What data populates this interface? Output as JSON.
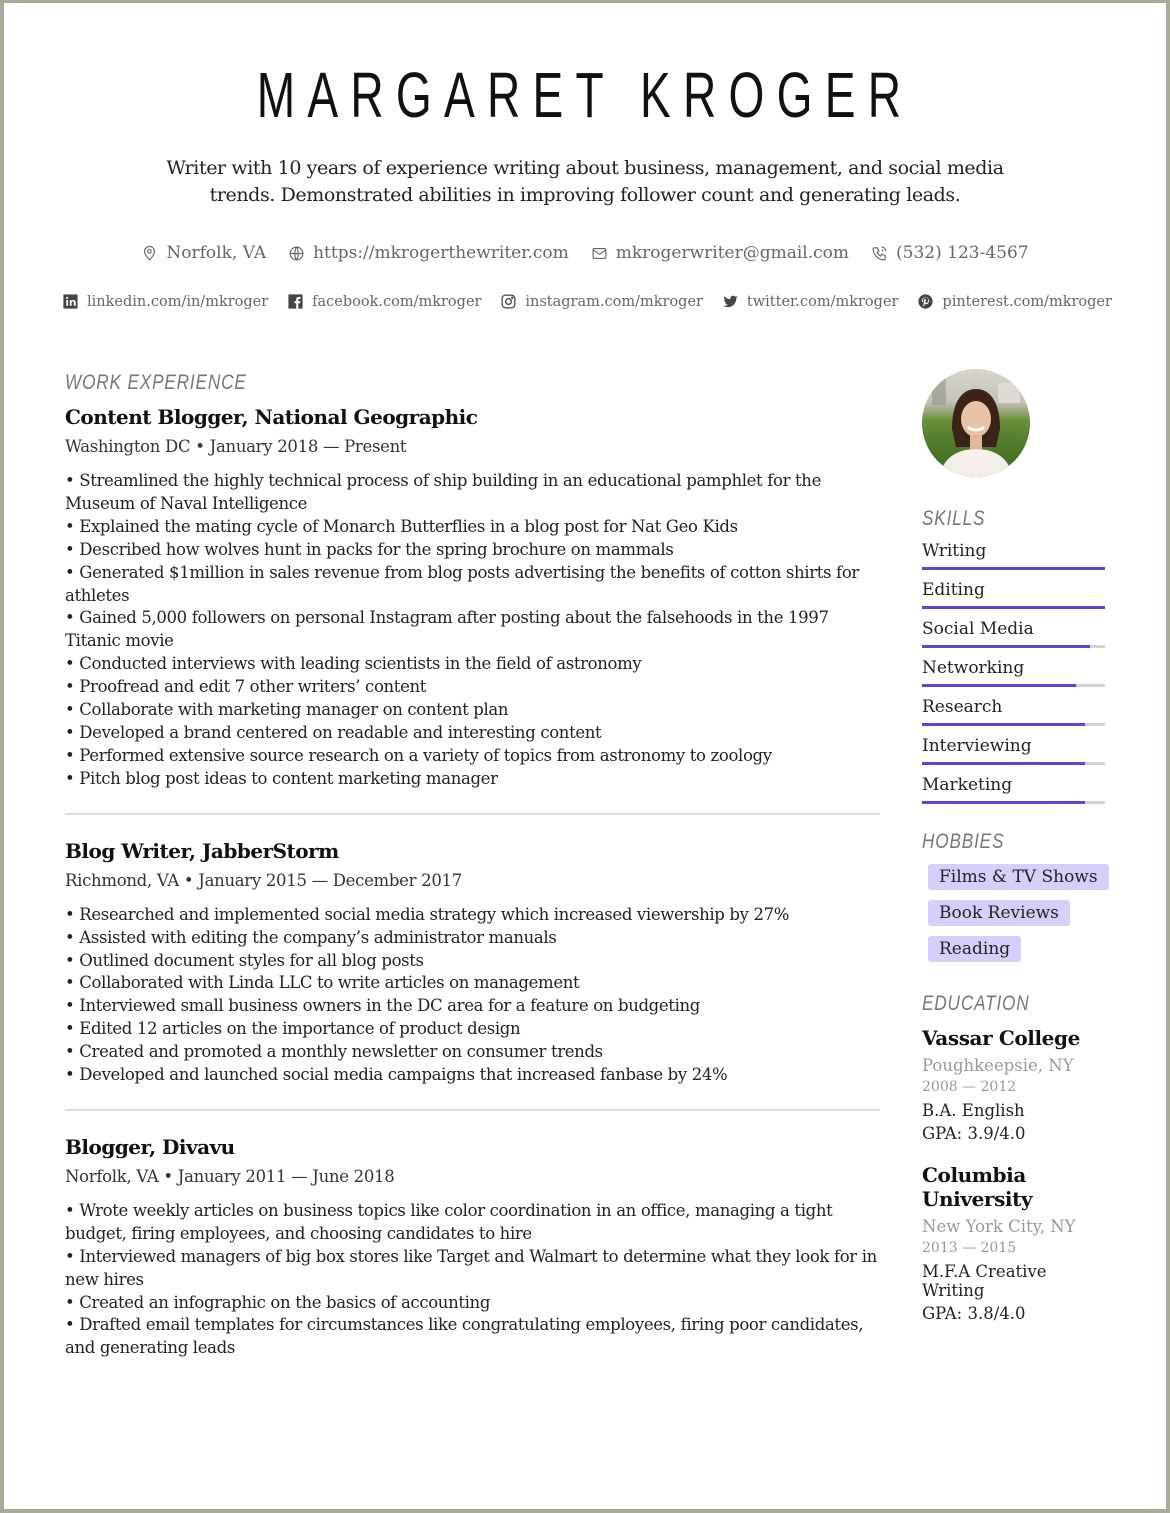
{
  "header": {
    "name": "MARGARET KROGER",
    "summary": "Writer with 10 years of experience writing about business, management, and social media trends. Demonstrated abilities in improving follower count and generating leads."
  },
  "contact": [
    {
      "icon": "location-pin-icon",
      "text": "Norfolk, VA"
    },
    {
      "icon": "globe-icon",
      "text": "https://mkrogerthewriter.com"
    },
    {
      "icon": "envelope-icon",
      "text": "mkrogerwriter@gmail.com"
    },
    {
      "icon": "phone-icon",
      "text": "(532) 123-4567"
    }
  ],
  "social": [
    {
      "icon": "linkedin-icon",
      "text": "linkedin.com/in/mkroger"
    },
    {
      "icon": "facebook-icon",
      "text": "facebook.com/mkroger"
    },
    {
      "icon": "instagram-icon",
      "text": "instagram.com/mkroger"
    },
    {
      "icon": "twitter-icon",
      "text": "twitter.com/mkroger"
    },
    {
      "icon": "pinterest-icon",
      "text": "pinterest.com/mkroger"
    }
  ],
  "work": {
    "title": "WORK EXPERIENCE",
    "jobs": [
      {
        "title": "Content Blogger, National Geographic",
        "meta": "Washington DC • January 2018 — Present",
        "bullets": [
          "• Streamlined the highly technical process of ship building in an educational pamphlet for the Museum of Naval Intelligence",
          "• Explained the mating cycle of Monarch Butterflies in a blog post for Nat Geo Kids",
          "• Described how wolves hunt in packs for the spring brochure on mammals",
          "• Generated $1million in sales revenue from blog posts advertising the benefits of cotton shirts for athletes",
          "• Gained 5,000 followers on personal Instagram after posting about the falsehoods in the 1997 Titanic movie",
          "• Conducted interviews with leading scientists in the field of astronomy",
          "• Proofread and edit 7 other writers’ content",
          "• Collaborate with marketing manager on content plan",
          "• Developed a brand centered on readable and interesting content",
          "• Performed extensive source research on a variety of topics from astronomy to zoology",
          "• Pitch blog post ideas to content marketing manager"
        ]
      },
      {
        "title": "Blog Writer, JabberStorm",
        "meta": "Richmond, VA • January 2015 — December 2017",
        "bullets": [
          "• Researched and implemented social media strategy which increased viewership by 27%",
          "• Assisted with editing the company’s administrator manuals",
          "• Outlined document styles for all blog posts",
          "• Collaborated with Linda LLC to write articles on management",
          "• Interviewed small business owners in the DC area for a feature on budgeting",
          "• Edited 12 articles on the importance of product design",
          "• Created and promoted a monthly newsletter on consumer trends",
          "• Developed and launched social media campaigns that increased fanbase by 24%"
        ]
      },
      {
        "title": "Blogger, Divavu",
        "meta": "Norfolk, VA • January 2011 — June 2018",
        "bullets": [
          "• Wrote weekly articles on business topics like color coordination in an office, managing a tight budget, firing employees, and choosing candidates to hire",
          "• Interviewed managers of big box stores like Target and Walmart to determine what they look for in new hires",
          "• Created an infographic on the basics of accounting",
          "• Drafted email templates for circumstances like congratulating employees, firing poor candidates, and generating leads"
        ]
      }
    ]
  },
  "skills": {
    "title": "SKILLS",
    "accent_color": "#5b45d6",
    "items": [
      {
        "label": "Writing",
        "level_percent": 100
      },
      {
        "label": "Editing",
        "level_percent": 100
      },
      {
        "label": "Social Media",
        "level_percent": 92
      },
      {
        "label": "Networking",
        "level_percent": 84
      },
      {
        "label": "Research",
        "level_percent": 89
      },
      {
        "label": "Interviewing",
        "level_percent": 89
      },
      {
        "label": "Marketing",
        "level_percent": 89
      }
    ]
  },
  "hobbies": {
    "title": "HOBBIES",
    "items": [
      "Films & TV Shows",
      "Book Reviews",
      "Reading"
    ]
  },
  "education": {
    "title": "EDUCATION",
    "schools": [
      {
        "name": "Vassar College",
        "location": "Poughkeepsie, NY",
        "years": "2008 — 2012",
        "degree": "B.A. English",
        "gpa": "GPA: 3.9/4.0"
      },
      {
        "name": "Columbia University",
        "location": "New York City, NY",
        "years": "2013 — 2015",
        "degree": "M.F.A Creative Writing",
        "gpa": "GPA: 3.8/4.0"
      }
    ]
  }
}
